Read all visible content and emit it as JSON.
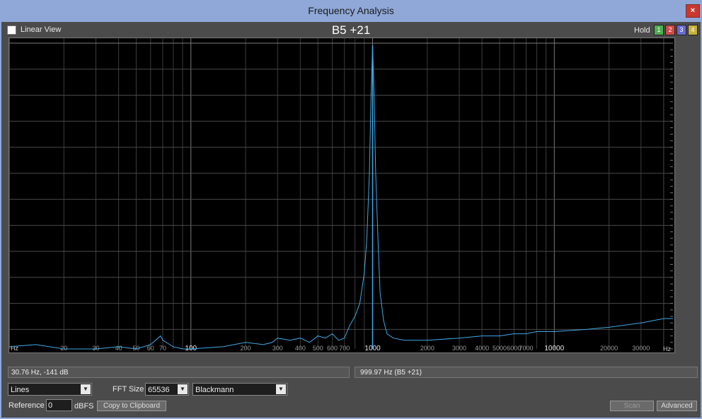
{
  "window": {
    "title": "Frequency Analysis",
    "close_glyph": "×"
  },
  "toolbar": {
    "linear_view_label": "Linear View",
    "linear_view_checked": false,
    "note_label": "B5 +21",
    "hold_label": "Hold",
    "hold_buttons": [
      {
        "label": "1",
        "color": "#4caf50"
      },
      {
        "label": "2",
        "color": "#d24a4a"
      },
      {
        "label": "3",
        "color": "#6a6ad0"
      },
      {
        "label": "4",
        "color": "#c8b03a"
      }
    ]
  },
  "chart_data": {
    "type": "line",
    "xscale": "log",
    "xlim": [
      10,
      45000
    ],
    "ylim": [
      -141,
      0
    ],
    "grid": true,
    "x_unit": "Hz",
    "y_unit": "dB",
    "x_ticks": [
      "20",
      "30",
      "40",
      "50",
      "60",
      "70",
      "100",
      "200",
      "300",
      "400",
      "500",
      "600",
      "700",
      "1000",
      "2000",
      "3000",
      "4000",
      "5000",
      "6000",
      "7000",
      "10000",
      "20000",
      "30000"
    ],
    "y_ticks": [
      "dB",
      "-12",
      "-24",
      "-36",
      "-48",
      "-60",
      "-72",
      "-84",
      "-96",
      "-108",
      "-120",
      "-132",
      "dB"
    ],
    "line_color": "#3fa9e6",
    "peak": {
      "x": 1000,
      "y": -1
    },
    "series": [
      {
        "x": [
          10,
          14,
          20,
          30,
          40,
          50,
          60,
          68,
          70,
          80,
          90,
          100,
          150,
          200,
          250,
          280,
          300,
          350,
          400,
          450,
          500,
          550,
          600,
          650,
          700,
          750,
          800,
          850,
          900,
          930,
          960,
          980,
          1000,
          1020,
          1040,
          1070,
          1100,
          1150,
          1200,
          1300,
          1500,
          2000,
          3000,
          4000,
          5000,
          6000,
          7000,
          8000,
          10000,
          15000,
          20000,
          30000,
          40000,
          45000
        ],
        "y": [
          -140,
          -139,
          -141,
          -141,
          -140,
          -141,
          -139,
          -135,
          -137,
          -140,
          -141,
          -141,
          -140,
          -138,
          -139,
          -138,
          -136,
          -137,
          -136,
          -138,
          -135,
          -136,
          -134,
          -137,
          -136,
          -130,
          -126,
          -120,
          -106,
          -90,
          -60,
          -25,
          -1,
          -25,
          -60,
          -90,
          -115,
          -128,
          -134,
          -136,
          -137,
          -137,
          -136,
          -135,
          -135,
          -134,
          -134,
          -133,
          -133,
          -132,
          -131,
          -129,
          -127,
          -127
        ]
      }
    ]
  },
  "status": {
    "cursor_readout": "30.76 Hz,   -141 dB",
    "peak_readout": "999.97 Hz (B5 +21)"
  },
  "controls": {
    "display_mode": "Lines",
    "fft_size_label": "FFT Size",
    "fft_size": "65536",
    "window_function": "Blackmann",
    "reference_label": "Reference",
    "reference_value": "0",
    "reference_unit": "dBFS",
    "copy_button": "Copy to Clipboard",
    "scan_button": "Scan",
    "advanced_button": "Advanced"
  }
}
